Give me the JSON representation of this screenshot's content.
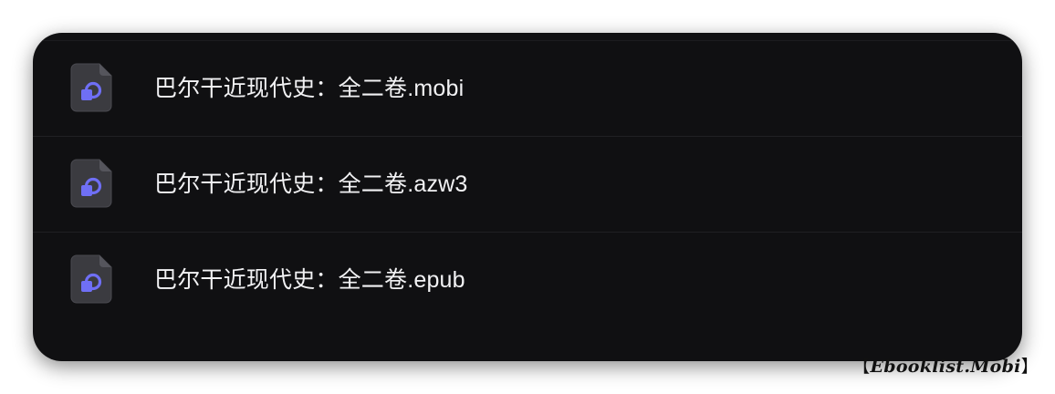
{
  "files": [
    {
      "name": "巴尔干近现代史：全二卷.mobi",
      "icon": "ebook-file-icon"
    },
    {
      "name": "巴尔干近现代史：全二卷.azw3",
      "icon": "ebook-file-icon"
    },
    {
      "name": "巴尔干近现代史：全二卷.epub",
      "icon": "ebook-file-icon"
    }
  ],
  "watermark": {
    "open": "【",
    "text": "Ebooklist.Mobi",
    "close": "】"
  },
  "colors": {
    "panel_background": "#101012",
    "icon_body": "#3b3b40",
    "icon_accent": "#6f6ff5",
    "text": "#f2f2f4"
  }
}
